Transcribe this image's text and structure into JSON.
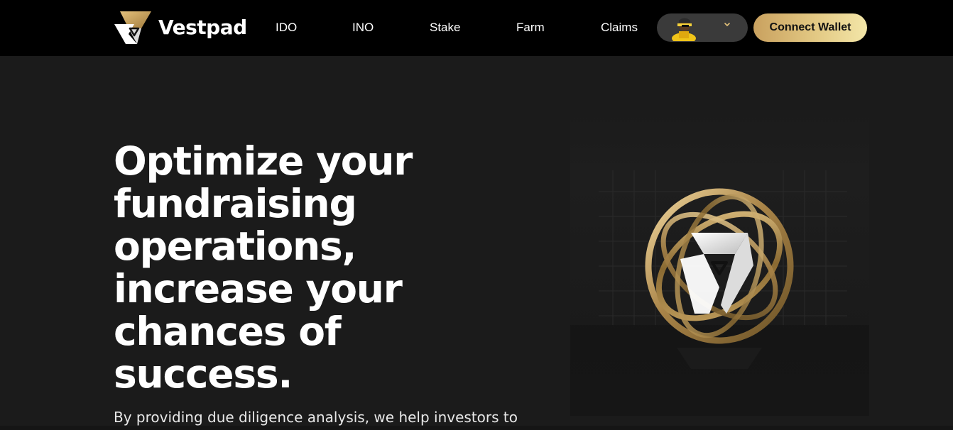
{
  "brand": {
    "name": "Vestpad",
    "accent_gold": "#d4b06a",
    "icon": "vestpad-logo-icon"
  },
  "nav": {
    "links": [
      {
        "label": "IDO"
      },
      {
        "label": "INO"
      },
      {
        "label": "Stake"
      },
      {
        "label": "Farm"
      },
      {
        "label": "Claims"
      }
    ],
    "profile": {
      "avatar_icon": "avatar-icon",
      "chevron_icon": "chevron-down-icon"
    },
    "connect_wallet_label": "Connect Wallet"
  },
  "hero": {
    "title_lines": [
      "Optimize your",
      "fundraising",
      "operations,",
      "increase your",
      "chances of",
      "success."
    ],
    "subtitle": "By providing due diligence analysis, we help investors to",
    "art_icon": "gold-rings-logo-illustration"
  }
}
